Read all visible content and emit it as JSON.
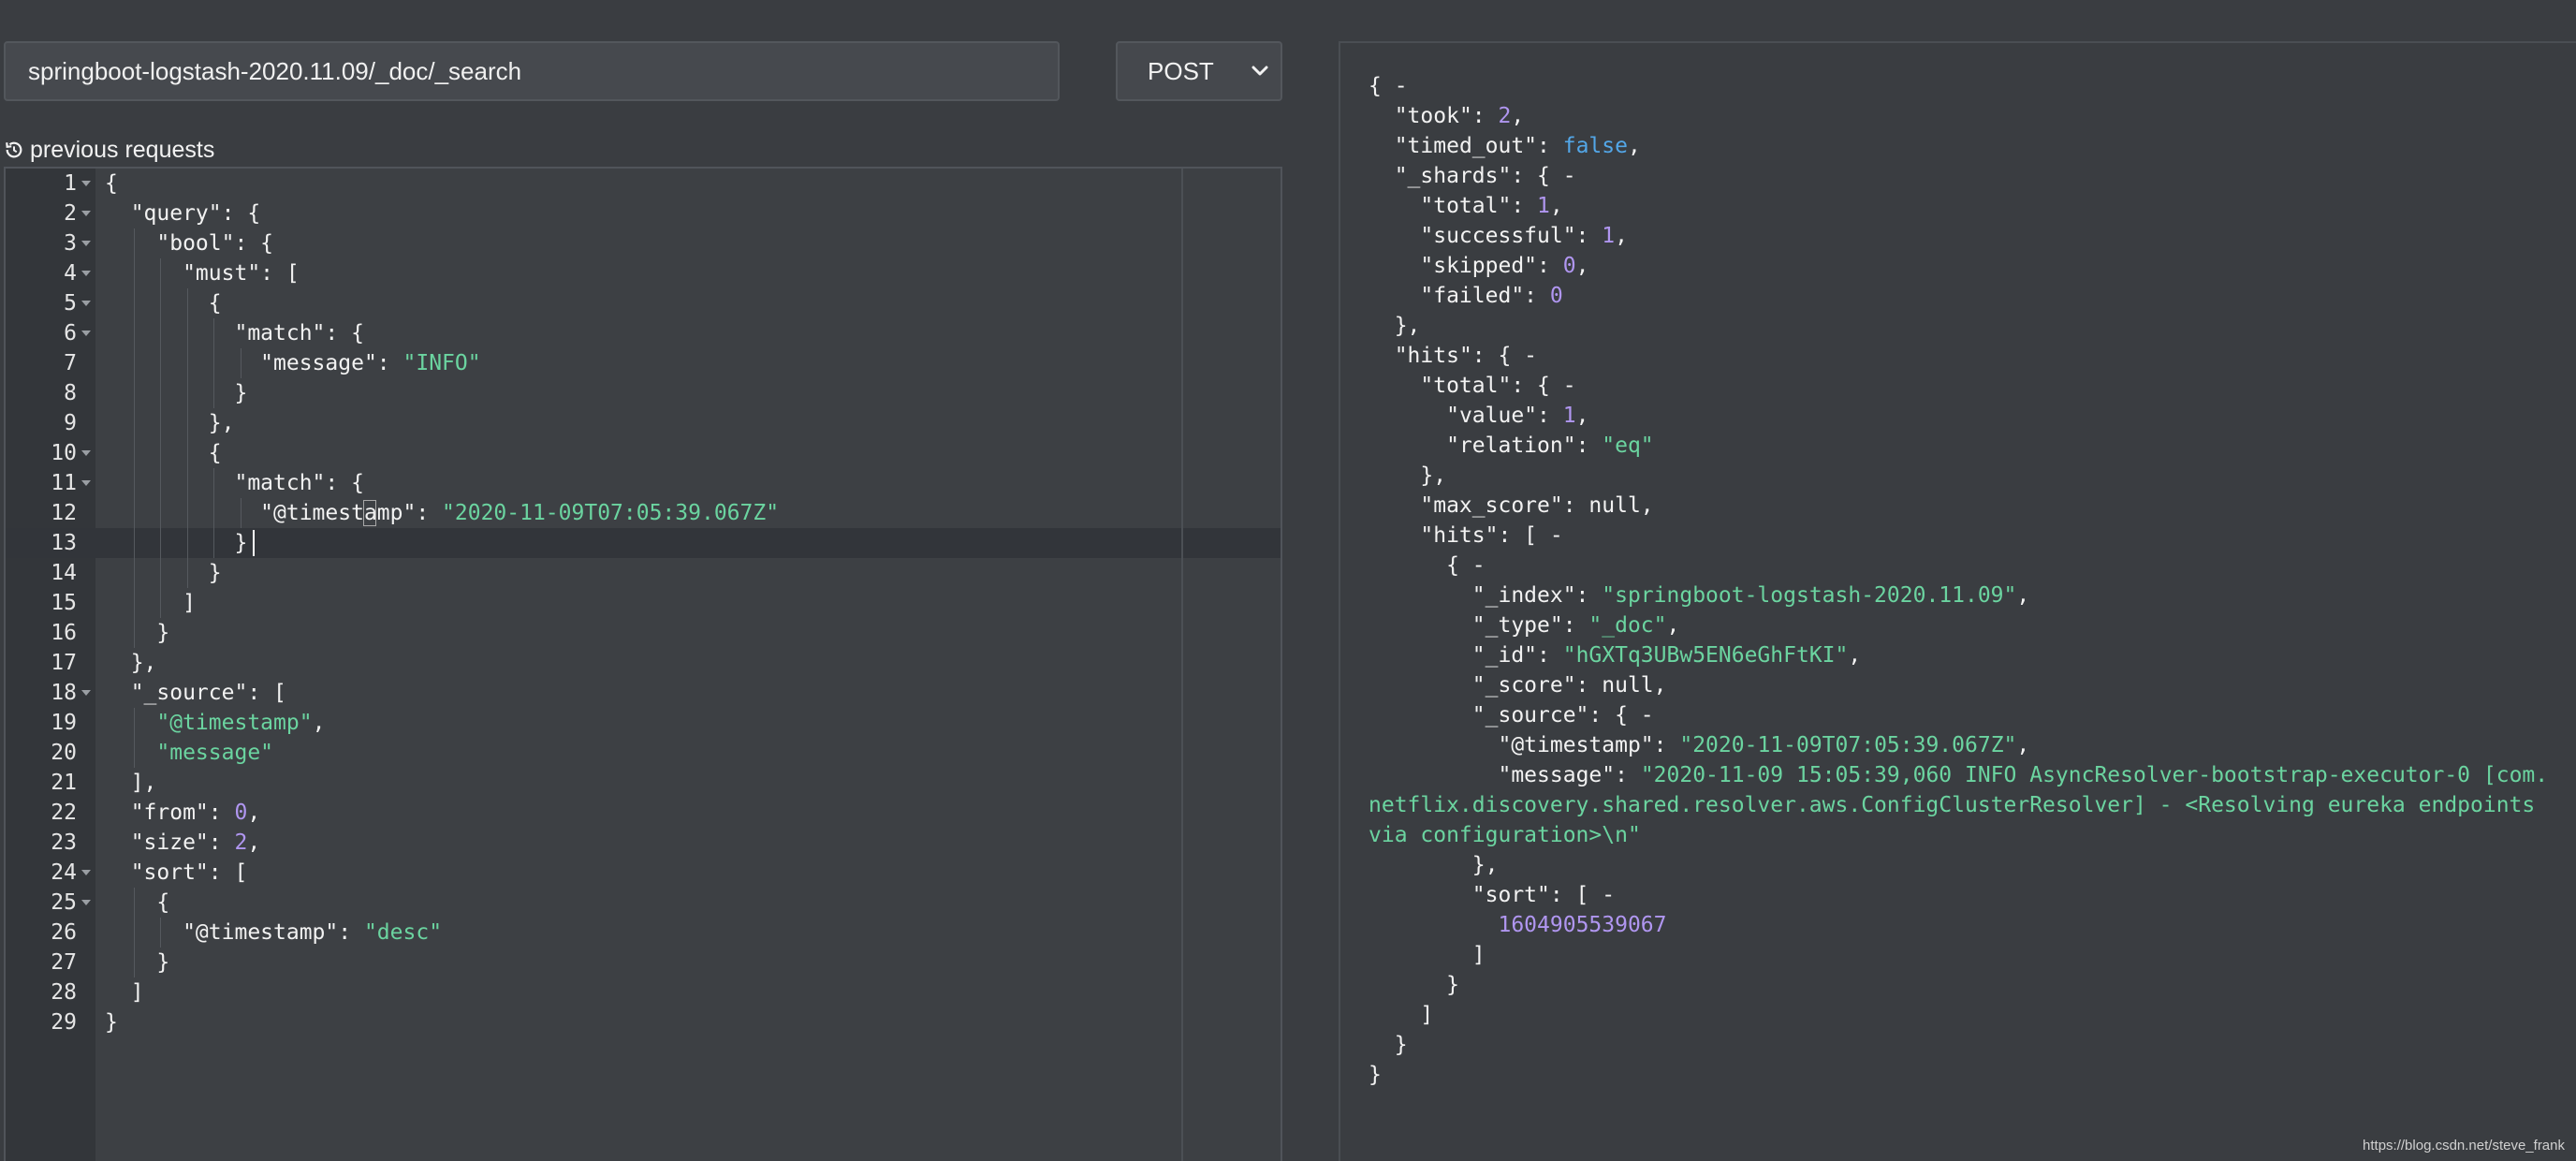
{
  "request": {
    "url": "springboot-logstash-2020.11.09/_doc/_search",
    "method": "POST",
    "method_options": [
      "POST"
    ],
    "history_label": "previous requests"
  },
  "editor": {
    "lines": [
      [
        [
          "p",
          "{"
        ]
      ],
      [
        [
          "p",
          "  \"query\": {"
        ]
      ],
      [
        [
          "p",
          "    \"bool\": {"
        ]
      ],
      [
        [
          "p",
          "      \"must\": ["
        ]
      ],
      [
        [
          "p",
          "        {"
        ]
      ],
      [
        [
          "p",
          "          \"match\": {"
        ]
      ],
      [
        [
          "p",
          "            \"message\": "
        ],
        [
          "s",
          "\"INFO\""
        ]
      ],
      [
        [
          "p",
          "          }"
        ]
      ],
      [
        [
          "p",
          "        },"
        ]
      ],
      [
        [
          "p",
          "        {"
        ]
      ],
      [
        [
          "p",
          "          \"match\": {"
        ]
      ],
      [
        [
          "p",
          "            \"@timestamp\": "
        ],
        [
          "s",
          "\"2020-11-09T07:05:39.067Z\""
        ]
      ],
      [
        [
          "p",
          "          }"
        ]
      ],
      [
        [
          "p",
          "        }"
        ]
      ],
      [
        [
          "p",
          "      ]"
        ]
      ],
      [
        [
          "p",
          "    }"
        ]
      ],
      [
        [
          "p",
          "  },"
        ]
      ],
      [
        [
          "p",
          "  \"_source\": ["
        ]
      ],
      [
        [
          "p",
          "    "
        ],
        [
          "s",
          "\"@timestamp\""
        ],
        [
          "p",
          ","
        ]
      ],
      [
        [
          "p",
          "    "
        ],
        [
          "s",
          "\"message\""
        ]
      ],
      [
        [
          "p",
          "  ],"
        ]
      ],
      [
        [
          "p",
          "  \"from\": "
        ],
        [
          "n",
          "0"
        ],
        [
          "p",
          ","
        ]
      ],
      [
        [
          "p",
          "  \"size\": "
        ],
        [
          "n",
          "2"
        ],
        [
          "p",
          ","
        ]
      ],
      [
        [
          "p",
          "  \"sort\": ["
        ]
      ],
      [
        [
          "p",
          "    {"
        ]
      ],
      [
        [
          "p",
          "      \"@timestamp\": "
        ],
        [
          "s",
          "\"desc\""
        ]
      ],
      [
        [
          "p",
          "    }"
        ]
      ],
      [
        [
          "p",
          "  ]"
        ]
      ],
      [
        [
          "p",
          "}"
        ]
      ]
    ],
    "foldable_lines": [
      1,
      2,
      3,
      4,
      5,
      6,
      10,
      11,
      18,
      24,
      25
    ]
  },
  "response": {
    "lines": [
      [
        [
          "p",
          "{ -"
        ]
      ],
      [
        [
          "p",
          "  \"took\": "
        ],
        [
          "n",
          "2"
        ],
        [
          "p",
          ","
        ]
      ],
      [
        [
          "p",
          "  \"timed_out\": "
        ],
        [
          "b",
          "false"
        ],
        [
          "p",
          ","
        ]
      ],
      [
        [
          "p",
          "  \"_shards\": { -"
        ]
      ],
      [
        [
          "p",
          "    \"total\": "
        ],
        [
          "n",
          "1"
        ],
        [
          "p",
          ","
        ]
      ],
      [
        [
          "p",
          "    \"successful\": "
        ],
        [
          "n",
          "1"
        ],
        [
          "p",
          ","
        ]
      ],
      [
        [
          "p",
          "    \"skipped\": "
        ],
        [
          "n",
          "0"
        ],
        [
          "p",
          ","
        ]
      ],
      [
        [
          "p",
          "    \"failed\": "
        ],
        [
          "n",
          "0"
        ]
      ],
      [
        [
          "p",
          "  },"
        ]
      ],
      [
        [
          "p",
          "  \"hits\": { -"
        ]
      ],
      [
        [
          "p",
          "    \"total\": { -"
        ]
      ],
      [
        [
          "p",
          "      \"value\": "
        ],
        [
          "n",
          "1"
        ],
        [
          "p",
          ","
        ]
      ],
      [
        [
          "p",
          "      \"relation\": "
        ],
        [
          "s",
          "\"eq\""
        ]
      ],
      [
        [
          "p",
          "    },"
        ]
      ],
      [
        [
          "p",
          "    \"max_score\": null,"
        ]
      ],
      [
        [
          "p",
          "    \"hits\": [ -"
        ]
      ],
      [
        [
          "p",
          "      { -"
        ]
      ],
      [
        [
          "p",
          "        \"_index\": "
        ],
        [
          "s",
          "\"springboot-logstash-2020.11.09\""
        ],
        [
          "p",
          ","
        ]
      ],
      [
        [
          "p",
          "        \"_type\": "
        ],
        [
          "s",
          "\"_doc\""
        ],
        [
          "p",
          ","
        ]
      ],
      [
        [
          "p",
          "        \"_id\": "
        ],
        [
          "s",
          "\"hGXTq3UBw5EN6eGhFtKI\""
        ],
        [
          "p",
          ","
        ]
      ],
      [
        [
          "p",
          "        \"_score\": null,"
        ]
      ],
      [
        [
          "p",
          "        \"_source\": { -"
        ]
      ],
      [
        [
          "p",
          "          \"@timestamp\": "
        ],
        [
          "s",
          "\"2020-11-09T07:05:39.067Z\""
        ],
        [
          "p",
          ","
        ]
      ],
      [
        [
          "p",
          "          \"message\": "
        ],
        [
          "s",
          "\"2020-11-09 15:05:39,060 INFO AsyncResolver-bootstrap-executor-0 [com.netflix.discovery.shared.resolver.aws.ConfigClusterResolver] - <Resolving eureka endpoints via configuration>\\n\""
        ]
      ],
      [
        [
          "p",
          "        },"
        ]
      ],
      [
        [
          "p",
          "        \"sort\": [ -"
        ]
      ],
      [
        [
          "p",
          "          "
        ],
        [
          "n",
          "1604905539067"
        ]
      ],
      [
        [
          "p",
          "        ]"
        ]
      ],
      [
        [
          "p",
          "      }"
        ]
      ],
      [
        [
          "p",
          "    ]"
        ]
      ],
      [
        [
          "p",
          "  }"
        ]
      ],
      [
        [
          "p",
          "}"
        ]
      ]
    ]
  },
  "watermark": "https://blog.csdn.net/steve_frank",
  "colors": {
    "background": "#3a3d41",
    "string": "#6bd4a0",
    "number": "#b096f0",
    "boolean": "#53a7e8"
  },
  "icons": {
    "history": "history-icon",
    "method_dropdown": "chevron-down-icon",
    "fold": "fold-arrow-icon"
  }
}
